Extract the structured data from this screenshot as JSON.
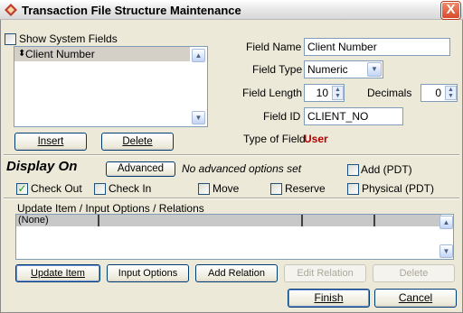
{
  "window": {
    "title": "Transaction File Structure Maintenance",
    "close_glyph": "X"
  },
  "fields_list": {
    "show_system_label": "Show System Fields",
    "items": [
      "Client Number"
    ],
    "insert_label": "Insert",
    "delete_label": "Delete"
  },
  "field_props": {
    "name_label": "Field Name",
    "name_value": "Client Number",
    "type_label": "Field Type",
    "type_value": "Numeric",
    "length_label": "Field Length",
    "length_value": "10",
    "decimals_label": "Decimals",
    "decimals_value": "0",
    "id_label": "Field ID",
    "id_value": "CLIENT_NO",
    "type_of_field_label": "Type of Field",
    "type_of_field_value": "User"
  },
  "display_on": {
    "heading": "Display On",
    "advanced_label": "Advanced",
    "advanced_status": "No advanced options set",
    "options": [
      {
        "label": "Add (PDT)",
        "checked": false
      },
      {
        "label": "Check Out",
        "checked": true
      },
      {
        "label": "Check In",
        "checked": false
      },
      {
        "label": "Move",
        "checked": false
      },
      {
        "label": "Reserve",
        "checked": false
      },
      {
        "label": "Physical (PDT)",
        "checked": false
      }
    ]
  },
  "update": {
    "heading": "Update Item / Input Options / Relations",
    "first_cell": "(None)",
    "buttons": [
      "Update Item",
      "Input Options",
      "Add Relation",
      "Edit Relation",
      "Delete"
    ]
  },
  "footer": {
    "finish_label": "Finish",
    "cancel_label": "Cancel"
  },
  "colors": {
    "accent_red": "#b20000",
    "border_blue": "#7f9db9",
    "face": "#ece9d8"
  }
}
